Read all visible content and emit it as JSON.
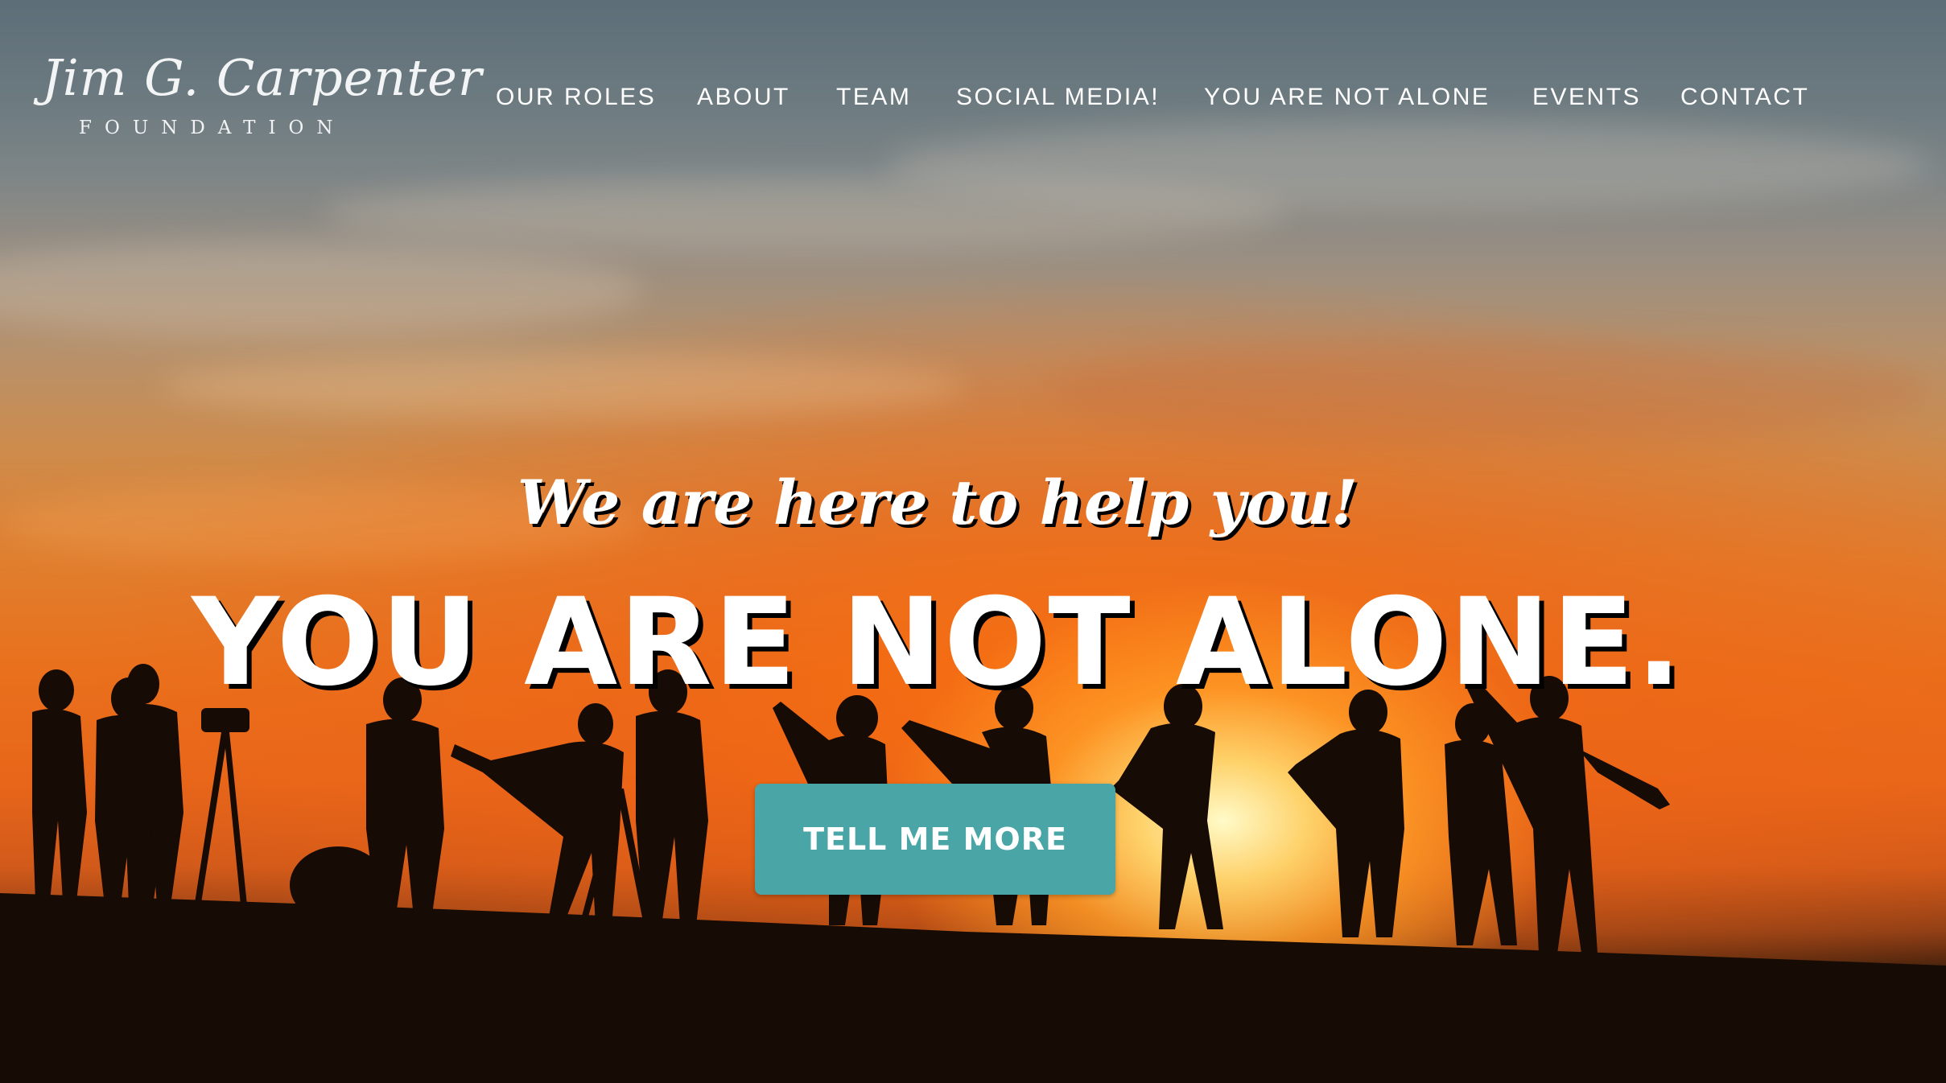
{
  "header": {
    "logo": {
      "script_text": "Jim G. Carpenter",
      "sub_text": "FOUNDATION"
    },
    "nav": [
      {
        "label": "OUR ROLES"
      },
      {
        "label": "ABOUT"
      },
      {
        "label": "TEAM"
      },
      {
        "label": "SOCIAL MEDIA!"
      },
      {
        "label": "YOU ARE NOT ALONE"
      },
      {
        "label": "EVENTS"
      },
      {
        "label": "CONTACT"
      }
    ]
  },
  "hero": {
    "tagline": "We are here to help you!",
    "headline": "YOU ARE NOT ALONE.",
    "cta_label": "TELL ME MORE",
    "background": "sunset-silhouettes-photo"
  },
  "colors": {
    "accent": "#4aa5a6",
    "text": "#ffffff",
    "sunset_orange": "#e8661a",
    "sky_blue_gray": "#5d6e78"
  }
}
